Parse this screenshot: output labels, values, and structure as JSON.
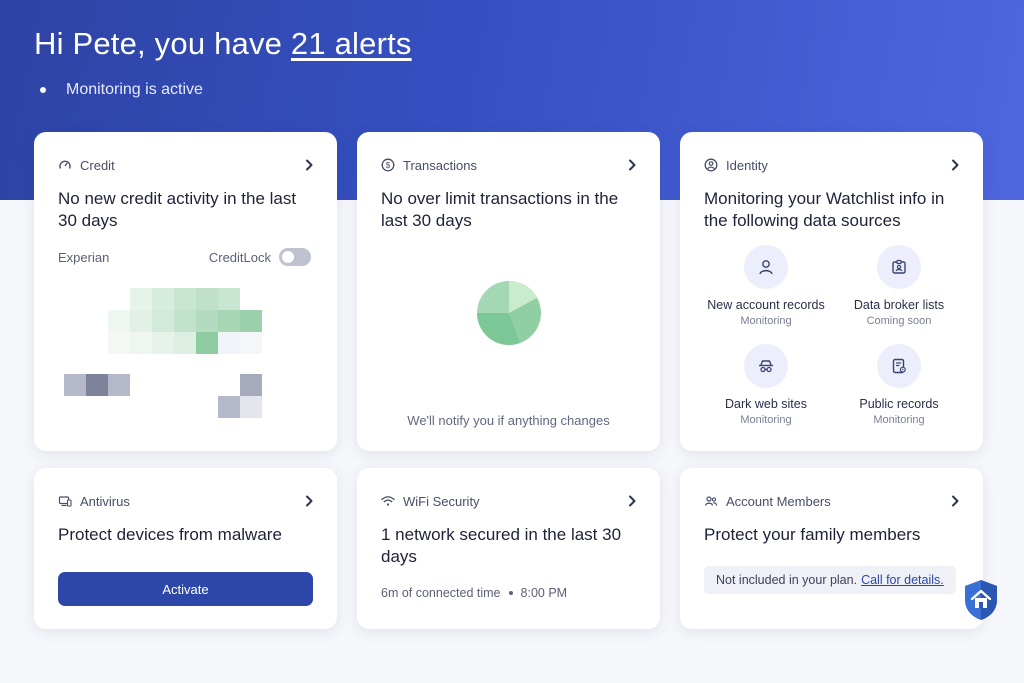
{
  "header": {
    "greeting_prefix": "Hi Pete, you have ",
    "alerts_link": "21 alerts",
    "status": "Monitoring is active"
  },
  "credit": {
    "title": "Credit",
    "icon": "gauge-icon",
    "headline": "No new credit activity in the last 30 days",
    "bureau": "Experian",
    "lock_label": "CreditLock",
    "lock_enabled": false
  },
  "transactions": {
    "title": "Transactions",
    "icon": "dollar-circle-icon",
    "headline": "No over limit transactions in the last 30 days",
    "notice": "We'll notify you if anything changes"
  },
  "identity": {
    "title": "Identity",
    "icon": "user-circle-icon",
    "headline": "Monitoring your Watchlist info in the following data sources",
    "sources": [
      {
        "label": "New account records",
        "status": "Monitoring",
        "icon": "person-icon"
      },
      {
        "label": "Data broker lists",
        "status": "Coming soon",
        "icon": "id-badge-icon"
      },
      {
        "label": "Dark web sites",
        "status": "Monitoring",
        "icon": "spy-icon"
      },
      {
        "label": "Public records",
        "status": "Monitoring",
        "icon": "document-pin-icon"
      }
    ]
  },
  "antivirus": {
    "title": "Antivirus",
    "icon": "devices-icon",
    "headline": "Protect devices from malware",
    "button": "Activate"
  },
  "wifi": {
    "title": "WiFi Security",
    "icon": "wifi-icon",
    "headline": "1 network secured in the last 30 days",
    "connected": "6m of connected time",
    "time": "8:00 PM"
  },
  "members": {
    "title": "Account Members",
    "icon": "people-icon",
    "headline": "Protect your family members",
    "plan_text": "Not included in your plan.",
    "plan_link": "Call for details."
  },
  "colors": {
    "hero_start": "#2e43a3",
    "hero_end": "#4f67de",
    "primary_button": "#2c47a8",
    "accent_green": "#7cc796"
  }
}
